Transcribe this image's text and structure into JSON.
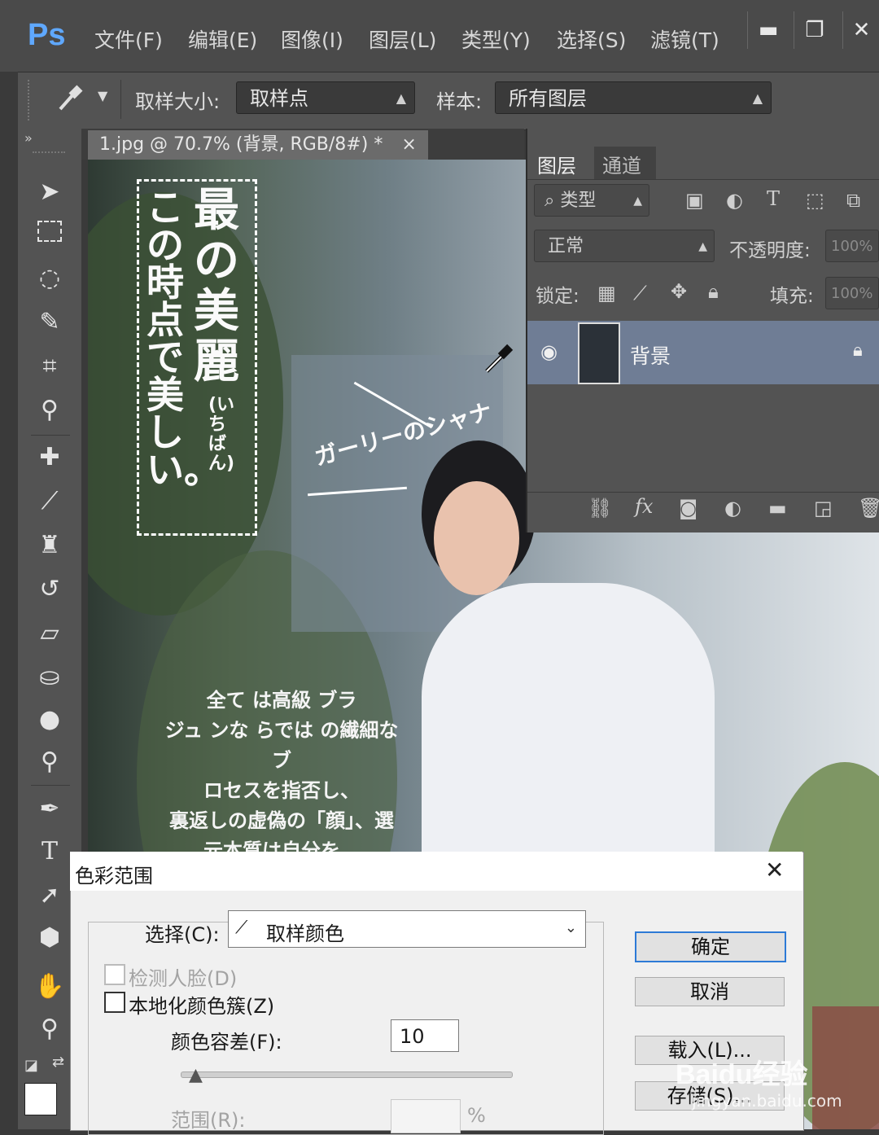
{
  "app": {
    "logo": "Ps"
  },
  "menu": [
    "文件(F)",
    "编辑(E)",
    "图像(I)",
    "图层(L)",
    "类型(Y)",
    "选择(S)",
    "滤镜(T)"
  ],
  "window_controls": {
    "minimize": "▬",
    "restore": "❐",
    "close": "✕"
  },
  "options_bar": {
    "sample_size_label": "取样大小:",
    "sample_size_value": "取样点",
    "sample_label": "样本:",
    "sample_value": "所有图层"
  },
  "document": {
    "tab_title": "1.jpg @ 70.7% (背景, RGB/8#) *",
    "tab_close": "×"
  },
  "canvas_text": {
    "vertical_col1": "最の美麗",
    "vertical_paren": "(いちばん)",
    "vertical_col2": "この時点で美しい。",
    "diagonal": "ガーリーのシャナ",
    "paragraph": [
      "全て は高級 ブラ",
      "ジュ ンな らでは の繊細な ブ",
      "ロセスを指否し、",
      "裏返しの虚偽の「顔」、選",
      "元本質は自分を。"
    ]
  },
  "layers_panel": {
    "tabs": [
      "图层",
      "通道"
    ],
    "filter_label": "类型",
    "blend_mode": "正常",
    "opacity_label": "不透明度:",
    "opacity_value": "100%",
    "lock_label": "锁定:",
    "fill_label": "填充:",
    "fill_value": "100%",
    "layer_name": "背景"
  },
  "dialog": {
    "title": "色彩范围",
    "close": "✕",
    "select_label": "选择(C):",
    "select_value": "取样颜色",
    "detect_faces": "检测人脸(D)",
    "localized": "本地化颜色簇(Z)",
    "fuzziness_label": "颜色容差(F):",
    "fuzziness_value": "10",
    "range_label": "范围(R):",
    "range_unit": "%",
    "buttons": {
      "ok": "确定",
      "cancel": "取消",
      "load": "载入(L)...",
      "save": "存储(S)..."
    }
  },
  "watermark": {
    "text": "Baidu经验",
    "url": "jingyan.baidu.com"
  }
}
